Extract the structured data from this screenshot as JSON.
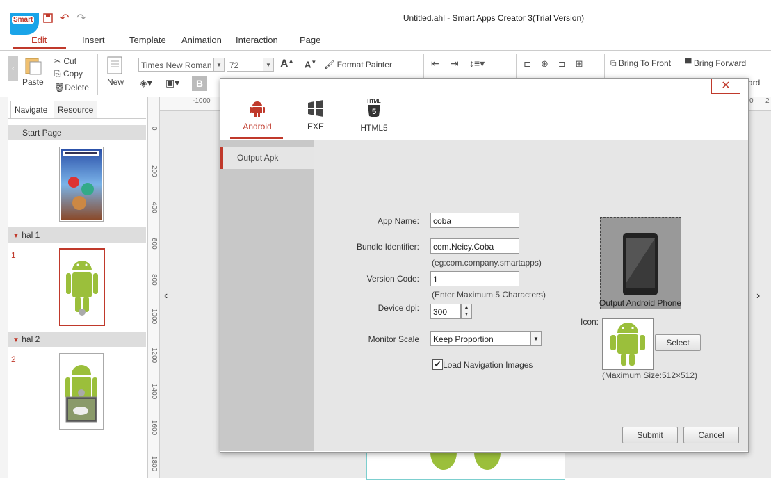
{
  "app": {
    "title": "Untitled.ahl - Smart Apps Creator 3(Trial Version)",
    "logo_text": "Smart"
  },
  "menu": [
    "Edit",
    "Insert",
    "Template",
    "Animation",
    "Interaction",
    "Page"
  ],
  "ribbon": {
    "paste": "Paste",
    "cut": "Cut",
    "copy": "Copy",
    "delete": "Delete",
    "new": "New",
    "font_name": "Times New Roman",
    "font_size": "72",
    "format_painter": "Format Painter",
    "bring_to_front": "Bring To Front",
    "bring_forward": "Bring Forward",
    "partial": "ard"
  },
  "left_panel": {
    "tabs": [
      "Navigate",
      "Resource"
    ],
    "pages": [
      {
        "label": "Start Page",
        "num": ""
      },
      {
        "label": "hal 1",
        "num": "1"
      },
      {
        "label": "hal 2",
        "num": "2"
      }
    ]
  },
  "ruler": {
    "h": [
      "-1000",
      "0",
      "2"
    ],
    "v": [
      "0",
      "200",
      "400",
      "600",
      "800",
      "1000",
      "1200",
      "1400",
      "1600",
      "1800"
    ]
  },
  "dialog": {
    "tabs": [
      {
        "label": "Android",
        "icon": "android-icon",
        "active": true
      },
      {
        "label": "EXE",
        "icon": "windows-icon"
      },
      {
        "label": "HTML5",
        "icon": "html5-icon",
        "badge": "HTML"
      }
    ],
    "side_item": "Output Apk",
    "form": {
      "app_name_label": "App Name:",
      "app_name": "coba",
      "bundle_label": "Bundle Identifier:",
      "bundle": "com.Neicy.Coba",
      "bundle_hint": "(eg:com.company.smartapps)",
      "version_label": "Version Code:",
      "version": "1",
      "version_hint": "(Enter Maximum 5 Characters)",
      "dpi_label": "Device dpi:",
      "dpi": "300",
      "scale_label": "Monitor Scale",
      "scale": "Keep Proportion",
      "nav_images_label": "Load Navigation Images",
      "nav_images_checked": true
    },
    "phone_caption": "Output Android Phone",
    "icon_label": "Icon:",
    "select_button": "Select",
    "icon_hint": "(Maximum Size:512×512)",
    "submit": "Submit",
    "cancel": "Cancel",
    "close": "✕"
  },
  "colors": {
    "accent": "#c0392b",
    "android": "#9bbf3b",
    "logo": "#1aa4e8"
  }
}
